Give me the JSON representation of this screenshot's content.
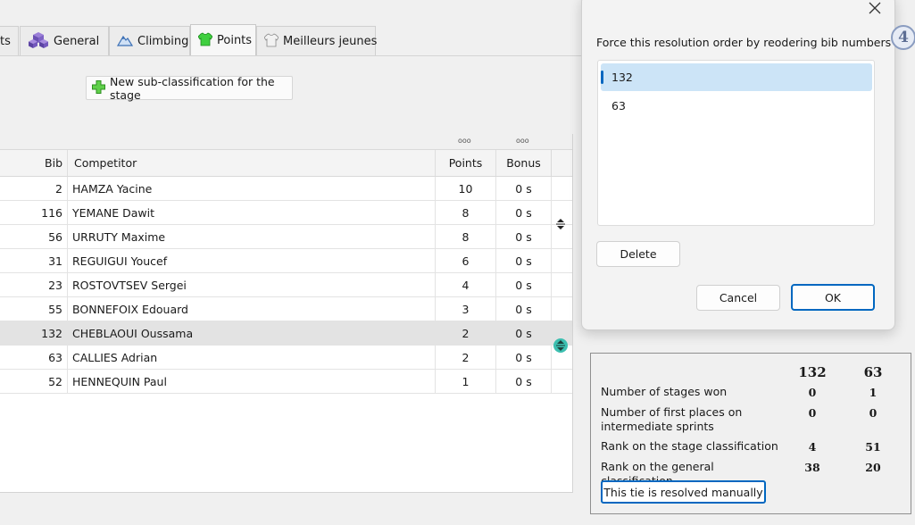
{
  "tabs": [
    {
      "label": "ts",
      "icon": "",
      "active": false
    },
    {
      "label": "General",
      "icon": "cubes-icon",
      "active": false
    },
    {
      "label": "Climbing",
      "icon": "mountain-icon",
      "active": false
    },
    {
      "label": "Points",
      "icon": "green-jersey-icon",
      "active": true
    },
    {
      "label": "Meilleurs jeunes",
      "icon": "white-jersey-icon",
      "active": false
    }
  ],
  "add_subclass_label": "New sub-classification for the stage",
  "table": {
    "headers": {
      "bib": "Bib",
      "competitor": "Competitor",
      "points": "Points",
      "bonus": "Bonus",
      "dots": "ooo"
    },
    "rows": [
      {
        "bib": "2",
        "name": "HAMZA Yacine",
        "points": "10",
        "bonus": "0 s"
      },
      {
        "bib": "116",
        "name": "YEMANE Dawit",
        "points": "8",
        "bonus": "0 s"
      },
      {
        "bib": "56",
        "name": "URRUTY Maxime",
        "points": "8",
        "bonus": "0 s"
      },
      {
        "bib": "31",
        "name": "REGUIGUI Youcef",
        "points": "6",
        "bonus": "0 s"
      },
      {
        "bib": "23",
        "name": "ROSTOVTSEV Sergei",
        "points": "4",
        "bonus": "0 s"
      },
      {
        "bib": "55",
        "name": "BONNEFOIX Edouard",
        "points": "3",
        "bonus": "0 s"
      },
      {
        "bib": "132",
        "name": "CHEBLAOUI Oussama",
        "points": "2",
        "bonus": "0 s"
      },
      {
        "bib": "63",
        "name": "CALLIES Adrian",
        "points": "2",
        "bonus": "0 s"
      },
      {
        "bib": "52",
        "name": "HENNEQUIN Paul",
        "points": "1",
        "bonus": "0 s"
      }
    ],
    "selected_row_bib": "132"
  },
  "dialog": {
    "instruction": "Force this resolution order by reodering bib numbers",
    "items": [
      "132",
      "63"
    ],
    "selected_item": "132",
    "delete_label": "Delete",
    "cancel_label": "Cancel",
    "ok_label": "OK",
    "accent": "#0067c0"
  },
  "stage_badge": "4",
  "comparison": {
    "bibs": [
      "132",
      "63"
    ],
    "rows": [
      {
        "label": "Number of stages won",
        "values": [
          "0",
          "1"
        ]
      },
      {
        "label": "Number of first places on intermediate sprints",
        "values": [
          "0",
          "0"
        ]
      },
      {
        "label": "Rank on the stage classification",
        "values": [
          "4",
          "51"
        ]
      },
      {
        "label": "Rank on the general classification",
        "values": [
          "38",
          "20"
        ]
      }
    ],
    "manual_label": "This tie is resolved manually"
  }
}
